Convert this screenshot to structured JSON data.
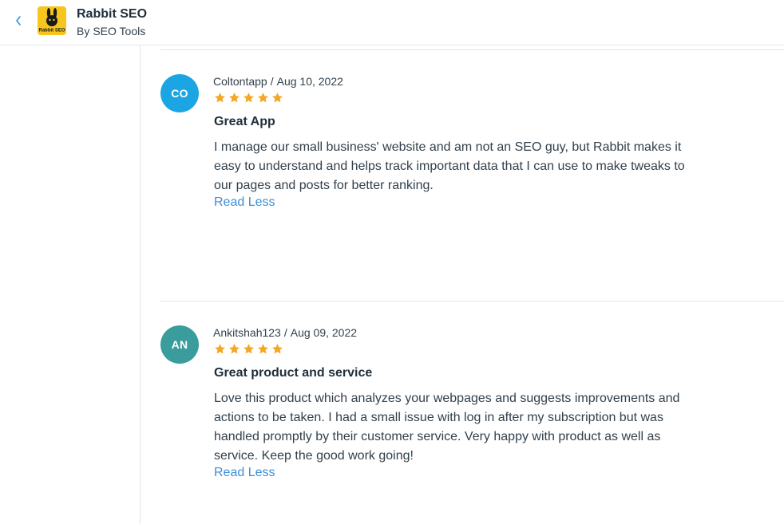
{
  "header": {
    "app_name": "Rabbit SEO",
    "by_label": "By",
    "developer": "SEO Tools",
    "logo_text": "Rabbit SEO"
  },
  "colors": {
    "accent": "#3b8ed8",
    "star": "#f5a623",
    "logo_bg": "#f7c51b",
    "avatar_co": "#1ba6e3",
    "avatar_an": "#3a9c9c"
  },
  "reviews": [
    {
      "initials": "CO",
      "author": "Coltontapp",
      "separator": "/",
      "date": "Aug 10, 2022",
      "rating": 5,
      "title": "Great App",
      "body": "I manage our small business' website and am not an SEO guy, but Rabbit makes it easy to understand and helps track important data that I can use to make tweaks to our pages and posts for better ranking.",
      "toggle_label": "Read Less"
    },
    {
      "initials": "AN",
      "author": "Ankitshah123",
      "separator": "/",
      "date": "Aug 09, 2022",
      "rating": 5,
      "title": "Great product and service",
      "body": "Love this product which analyzes your webpages and suggests improvements and actions to be taken. I had a small issue with log in after my subscription but was handled promptly by their customer service. Very happy with product as well as service. Keep the good work going!",
      "toggle_label": "Read Less"
    }
  ]
}
